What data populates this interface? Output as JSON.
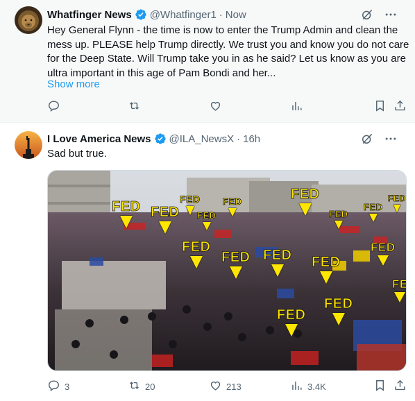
{
  "tweets": [
    {
      "author": "Whatfinger News",
      "handle": "@Whatfinger1",
      "time": "Now",
      "text": "Hey General Flynn - the time is now to enter the Trump Admin and clean the mess up. PLEASE help Trump directly. We trust you and know you do not care for the Deep State. Will Trump take you in as he said? Let us know as you are ultra important in this age of Pam Bondi and her...",
      "show_more": "Show more",
      "avatar_icon": "lion-avatar",
      "actions": {
        "reply": "",
        "retweet": "",
        "like": "",
        "views": ""
      }
    },
    {
      "author": "I Love America News",
      "handle": "@ILA_NewsX",
      "time": "16h",
      "text": "Sad but true.",
      "avatar_icon": "statue-of-liberty-avatar",
      "actions": {
        "reply": "3",
        "retweet": "20",
        "like": "213",
        "views": "3.4K"
      },
      "media_labels": [
        "FED",
        "FED",
        "FED",
        "FED",
        "FED",
        "FED",
        "FED",
        "FED",
        "FED",
        "FED",
        "FED",
        "FED",
        "FED",
        "FED",
        "FED",
        "FED",
        "FE"
      ]
    }
  ],
  "colors": {
    "accent": "#1d9bf0",
    "verified": "#1d9bf0",
    "label_yellow": "#ffe600",
    "muted": "#536471"
  }
}
